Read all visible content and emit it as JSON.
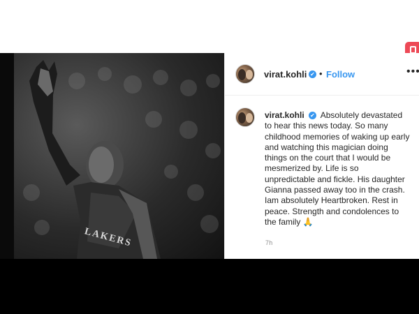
{
  "post": {
    "username": "virat.kohli",
    "verified_icon": "✔",
    "separator": "•",
    "follow_label": "Follow",
    "more_label": "•••",
    "caption": "Absolutely devastated to hear this news today. So many childhood memories of waking up early and watching this magician doing things on the court that I would be mesmerized by. Life is so unpredictable and fickle. His daughter Gianna passed away too in the crash. Iam absolutely Heartbroken. Rest in peace. Strength and condolences to the family 🙏",
    "timestamp": "7h",
    "image_jersey_text": "LAKERS"
  },
  "colors": {
    "follow_blue": "#3897f0",
    "badge_red": "#ed4956",
    "text_dark": "#262626",
    "text_muted": "#8e8e8e"
  }
}
